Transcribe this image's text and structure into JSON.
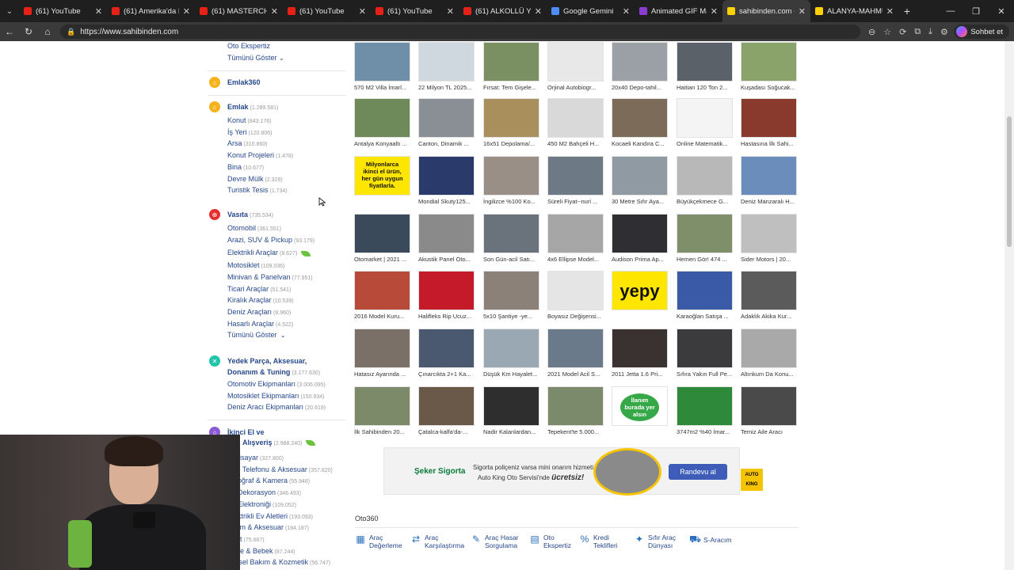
{
  "tabs": [
    {
      "label": "(61) YouTube",
      "color": "#e62117"
    },
    {
      "label": "(61) Amerika'da Poli...",
      "color": "#e62117"
    },
    {
      "label": "(61) MASTERCHEF YA...",
      "color": "#e62117"
    },
    {
      "label": "(61) YouTube",
      "color": "#e62117"
    },
    {
      "label": "(61) YouTube",
      "color": "#e62117"
    },
    {
      "label": "(61) ALKOLLÜ YILBAŞ...",
      "color": "#e62117"
    },
    {
      "label": "Google Gemini",
      "color": "#4d8bf5"
    },
    {
      "label": "Animated GIF Maker",
      "color": "#8b3bd0"
    },
    {
      "label": "sahibinden.com - Tü...",
      "color": "#ffd100"
    },
    {
      "label": "ALANYA-MAHMUTL...",
      "color": "#ffd100"
    }
  ],
  "address": {
    "url": "https://www.sahibinden.com",
    "chat_label": "Sohbet et"
  },
  "sidebar": {
    "top_links": [
      {
        "label": "Oto Ekspertiz",
        "count": ""
      },
      {
        "label": "Tümünü Göster",
        "count": ""
      }
    ],
    "emlak360": {
      "label": "Emlak360"
    },
    "emlak": {
      "label": "Emlak",
      "count": "(1.289.581)",
      "items": [
        {
          "label": "Konut",
          "count": "(843.176)"
        },
        {
          "label": "İş Yeri",
          "count": "(120.806)"
        },
        {
          "label": "Arsa",
          "count": "(310.860)"
        },
        {
          "label": "Konut Projeleri",
          "count": "(1.478)"
        },
        {
          "label": "Bina",
          "count": "(10.677)"
        },
        {
          "label": "Devre Mülk",
          "count": "(2.329)"
        },
        {
          "label": "Turistik Tesis",
          "count": "(1.734)"
        }
      ]
    },
    "vasita": {
      "label": "Vasıta",
      "count": "(735.534)",
      "items": [
        {
          "label": "Otomobil",
          "count": "(361.551)"
        },
        {
          "label": "Arazi, SUV & Pickup",
          "count": "(93.179)"
        },
        {
          "label": "Elektrikli Araçlar",
          "count": "(8.627)"
        },
        {
          "label": "Motosiklet",
          "count": "(109.036)"
        },
        {
          "label": "Minivan & Panelvan",
          "count": "(77.951)"
        },
        {
          "label": "Ticari Araçlar",
          "count": "(51.541)"
        },
        {
          "label": "Kiralık Araçlar",
          "count": "(10.539)"
        },
        {
          "label": "Deniz Araçları",
          "count": "(8.960)"
        },
        {
          "label": "Hasarlı Araçlar",
          "count": "(4.522)"
        },
        {
          "label": "Tümünü Göster",
          "count": ""
        }
      ]
    },
    "yedek": {
      "label_line1": "Yedek Parça, Aksesuar,",
      "label_line2": "Donanım & Tuning",
      "count": "(3.177.630)",
      "items": [
        {
          "label": "Otomotiv Ekipmanları",
          "count": "(3.006.095)"
        },
        {
          "label": "Motosiklet Ekipmanları",
          "count": "(150.934)"
        },
        {
          "label": "Deniz Aracı Ekipmanları",
          "count": "(20.619)"
        }
      ]
    },
    "ikinci": {
      "label_line1": "İkinci El ve",
      "label_line2": "Alışveriş",
      "count": "(2.988.240)",
      "items": [
        {
          "label": "Bilgisayar",
          "count": "(327.800)"
        },
        {
          "label": "Cep Telefonu & Aksesuar",
          "count": "(357.620)"
        },
        {
          "label": "Fotoğraf & Kamera",
          "count": "(55.948)"
        },
        {
          "label": "Ev Dekorasyon",
          "count": "(346.493)"
        },
        {
          "label": "Ev Elektroniği",
          "count": "(109.052)"
        },
        {
          "label": "Elektrikli Ev Aletleri",
          "count": "(193.093)"
        },
        {
          "label": "Giyim & Aksesuar",
          "count": "(184.187)"
        },
        {
          "label": "Saat",
          "count": "(75.667)"
        },
        {
          "label": "Anne & Bebek",
          "count": "(87.244)"
        },
        {
          "label": "Kişisel Bakım & Kozmetik",
          "count": "(56.747)"
        }
      ]
    }
  },
  "listings": [
    [
      "570 M2 Villa İmarl...",
      "22 Milyon TL 2025...",
      "Fırsat: Tem Gişele...",
      "Orjinal Autobiogr...",
      "20x40 Depo-tahil...",
      "Haitian 120 Ton 2...",
      "Kuşadası Soğucak..."
    ],
    [
      "Antalya Konyaaltı ...",
      "Canton, Dinamik ...",
      "16x51 Depolama/...",
      "450 M2 Bahçeli H...",
      "Kocaeli Kandıra C...",
      "Online Matematik...",
      "Hastasına İlk Sahi..."
    ],
    [
      "",
      "Mondial Skuty125...",
      "İngilizce %100 Ko...",
      "Süreli Fiyat--nuri ...",
      "30 Metre Sıfır Aya...",
      "Büyükçekmece G...",
      "Deniz Manzaralı H..."
    ],
    [
      "Otomarket | 2021 ...",
      "Akustik Panel Oto...",
      "Son Gün-acil Satı...",
      "4x6 Ellipse Model...",
      "Audison Prima Ap...",
      "Hemen Gör! 474 ...",
      "Sider Motors | 20..."
    ],
    [
      "2016 Model Kuru...",
      "Halifleks Rip Ucuz...",
      "5x10 Şantiye -ye...",
      "Boyasız Değişensi...",
      "",
      "Karaoğlan Satışa ...",
      "Adaklık Akika Kur..."
    ],
    [
      "Hatasız Ayarında ...",
      "Çınarcıkta 2+1 Ka...",
      "Düşük Km Hayalet...",
      "2021 Model Acil S...",
      "2011 Jetta 1.6 Pri...",
      "Sıfıra Yakın Full Pe...",
      "Altınkum Da Konu..."
    ],
    [
      "İlk Sahibinden 20...",
      "Çatalca-kalfa'da-...",
      "Nadir Kalanlardan...",
      "Tepekent'te 5.000...",
      "",
      "3747m2 %40 İmar...",
      "Temiz Aile Aracı"
    ]
  ],
  "special_tiles": {
    "yellow_ad": "Milyonlarca ikinci el ürün, her gün uygun fiyatlarla.",
    "yepy": "yepy",
    "ilan": "İlanım burada yer alsın"
  },
  "ad": {
    "brand": "Şeker Sigorta",
    "line1": "Sigorta poliçeniz varsa mini onarım hizmeti",
    "line2_prefix": "Auto King Oto Servisi'nde ",
    "line2_bold": "ücretsiz!",
    "button": "Randevu al",
    "auto_king": "AUTO KING"
  },
  "oto360": {
    "title": "Oto360",
    "items": [
      {
        "l1": "Araç",
        "l2": "Değerleme",
        "icon": "chart-icon"
      },
      {
        "l1": "Araç",
        "l2": "Karşılaştırma",
        "icon": "arrows-icon"
      },
      {
        "l1": "Araç Hasar",
        "l2": "Sorgulama",
        "icon": "wrench-icon"
      },
      {
        "l1": "Oto",
        "l2": "Ekspertiz",
        "icon": "doc-icon"
      },
      {
        "l1": "Kredi",
        "l2": "Teklifleri",
        "icon": "percent-icon"
      },
      {
        "l1": "Sıfır Araç",
        "l2": "Dünyası",
        "icon": "sparkle-icon"
      },
      {
        "l1": "S-Aracım",
        "l2": "",
        "icon": "car-icon"
      }
    ]
  }
}
